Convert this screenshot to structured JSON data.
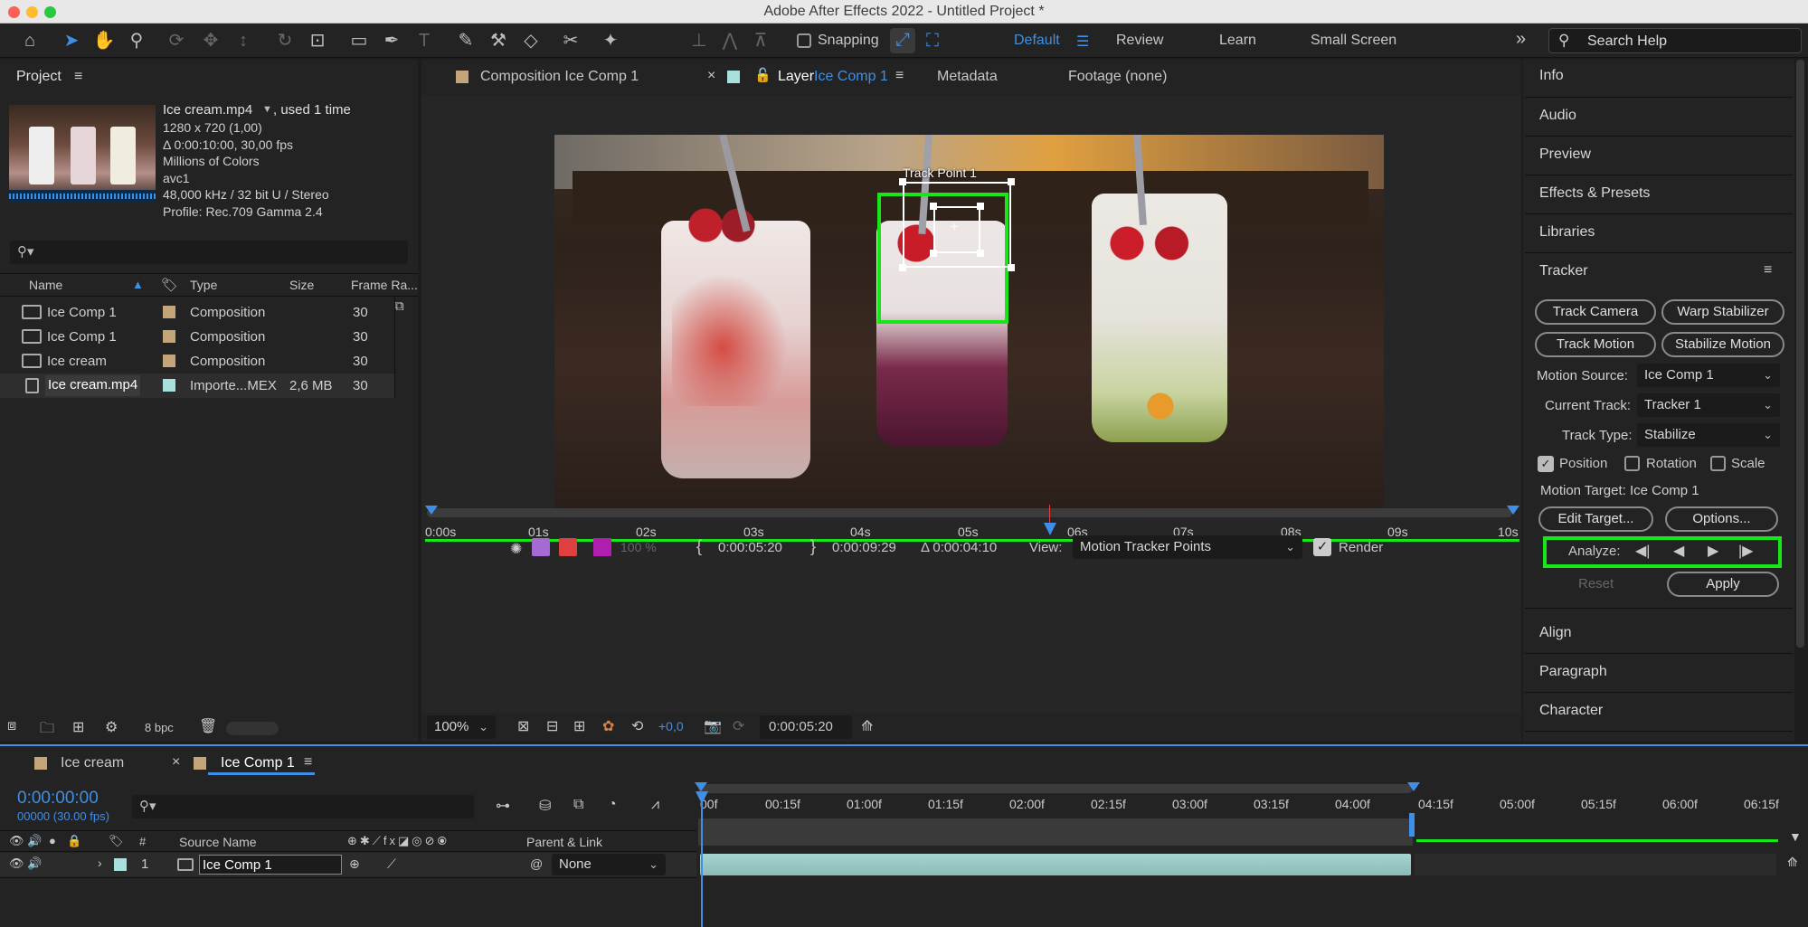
{
  "window": {
    "title": "Adobe After Effects 2022 - Untitled Project *"
  },
  "toolbar": {
    "snapping_label": "Snapping",
    "workspaces": [
      "Default",
      "Review",
      "Learn",
      "Small Screen"
    ],
    "search_placeholder": "Search Help",
    "overflow": "»"
  },
  "project": {
    "panel_title": "Project",
    "footage_name": "Ice cream.mp4",
    "used": ", used 1 time",
    "info_lines": [
      "1280 x 720 (1,00)",
      "Δ 0:00:10:00, 30,00 fps",
      "Millions of Colors",
      "avc1",
      "48,000 kHz / 32 bit U / Stereo",
      "Profile: Rec.709 Gamma 2.4"
    ],
    "columns": {
      "name": "Name",
      "type": "Type",
      "size": "Size",
      "frame_rate": "Frame Ra..."
    },
    "items": [
      {
        "name": "Ice Comp 1",
        "type": "Composition",
        "size": "",
        "fps": "30",
        "color": "#c4a57a"
      },
      {
        "name": "Ice Comp 1",
        "type": "Composition",
        "size": "",
        "fps": "30",
        "color": "#c4a57a"
      },
      {
        "name": "Ice cream",
        "type": "Composition",
        "size": "",
        "fps": "30",
        "color": "#c4a57a"
      },
      {
        "name": "Ice cream.mp4",
        "type": "Importe...MEX",
        "size": "2,6 MB",
        "fps": "30",
        "color": "#a8e0dd"
      }
    ],
    "bpc": "8 bpc"
  },
  "viewer": {
    "tabs": {
      "composition": "Composition Ice Comp 1",
      "layer_prefix": "Layer",
      "layer_name": "Ice Comp 1",
      "metadata": "Metadata",
      "footage": "Footage (none)"
    },
    "track_point": "Track Point 1",
    "ruler_labels": [
      "0:00s",
      "01s",
      "02s",
      "03s",
      "04s",
      "05s",
      "06s",
      "07s",
      "08s",
      "09s",
      "10s"
    ],
    "opacity": "100 %",
    "in_time": "0:00:05:20",
    "out_time": "0:00:09:29",
    "duration": "Δ 0:00:04:10",
    "view_label": "View:",
    "view_value": "Motion Tracker Points",
    "render_label": "Render",
    "zoom": "100%",
    "exposure": "+0,0",
    "current_time": "0:00:05:20"
  },
  "right_panel": {
    "items_top": [
      "Info",
      "Audio",
      "Preview",
      "Effects & Presets",
      "Libraries"
    ],
    "tracker": {
      "title": "Tracker",
      "buttons": [
        "Track Camera",
        "Warp Stabilizer",
        "Track Motion",
        "Stabilize Motion"
      ],
      "motion_source_label": "Motion Source:",
      "motion_source": "Ice Comp 1",
      "current_track_label": "Current Track:",
      "current_track": "Tracker 1",
      "track_type_label": "Track Type:",
      "track_type": "Stabilize",
      "position": "Position",
      "rotation": "Rotation",
      "scale": "Scale",
      "motion_target": "Motion Target: Ice Comp 1",
      "edit_target": "Edit Target...",
      "options": "Options...",
      "analyze": "Analyze:",
      "reset": "Reset",
      "apply": "Apply"
    },
    "items_bottom": [
      "Align",
      "Paragraph",
      "Character"
    ]
  },
  "timeline": {
    "tabs": [
      "Ice cream",
      "Ice Comp 1"
    ],
    "current_time": "0:00:00:00",
    "fps_line": "00000 (30.00 fps)",
    "ruler": [
      "00f",
      "00:15f",
      "01:00f",
      "01:15f",
      "02:00f",
      "02:15f",
      "03:00f",
      "03:15f",
      "04:00f",
      "04:15f",
      "05:00f",
      "05:15f",
      "06:00f",
      "06:15f"
    ],
    "source_name_header": "Source Name",
    "parent_header": "Parent & Link",
    "layer": {
      "number": "1",
      "name": "Ice Comp 1",
      "parent": "None"
    },
    "hash": "#"
  },
  "colors": {
    "accent": "#3f8fe6",
    "highlight_green": "#19e619",
    "panel": "#232323",
    "dark": "#1b1b1b"
  }
}
